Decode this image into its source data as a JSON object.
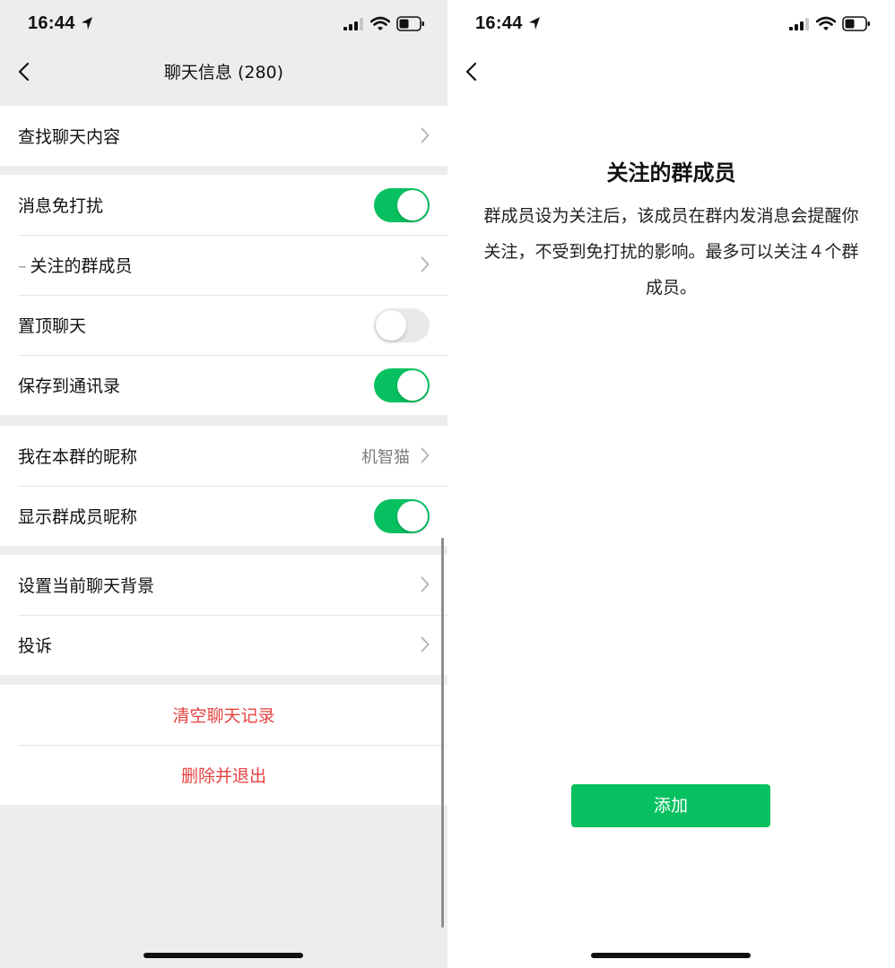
{
  "status_bar": {
    "time": "16:44"
  },
  "left": {
    "nav": {
      "title": "聊天信息 (280)"
    },
    "sections": {
      "search": {
        "label": "查找聊天内容"
      },
      "mute": {
        "label": "消息免打扰",
        "enabled": true
      },
      "starred": {
        "prefix": "–",
        "label": "关注的群成员"
      },
      "pin": {
        "label": "置顶聊天",
        "enabled": false
      },
      "save_contacts": {
        "label": "保存到通讯录",
        "enabled": true
      },
      "nickname": {
        "label": "我在本群的昵称",
        "value": "机智猫"
      },
      "show_nicknames": {
        "label": "显示群成员昵称",
        "enabled": true
      },
      "background": {
        "label": "设置当前聊天背景"
      },
      "complain": {
        "label": "投诉"
      },
      "clear_history": {
        "label": "清空聊天记录"
      },
      "delete_exit": {
        "label": "删除并退出"
      }
    }
  },
  "right": {
    "title": "关注的群成员",
    "description": "群成员设为关注后，该成员在群内发消息会提醒你关注，不受到免打扰的影响。最多可以关注４个群成员。",
    "add_button": "添加"
  },
  "colors": {
    "accent_green": "#07c160",
    "danger_red": "#e64340",
    "background_gray": "#ededed"
  }
}
